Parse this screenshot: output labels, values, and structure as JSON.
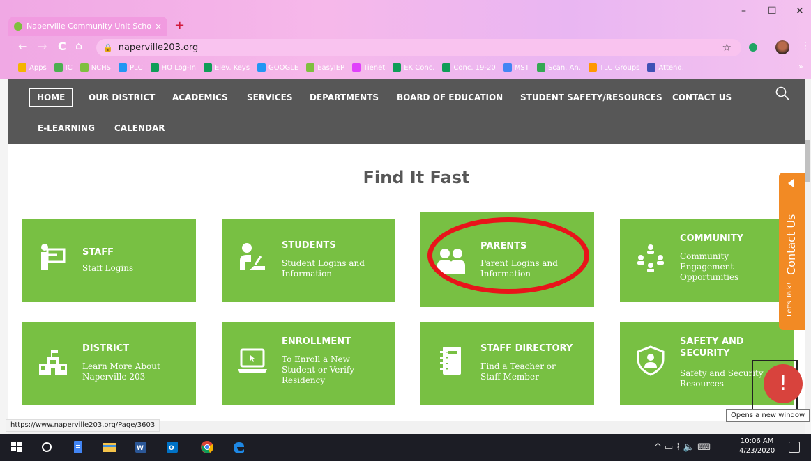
{
  "browser": {
    "tab_title": "Naperville Community Unit Scho",
    "tab_close": "×",
    "new_tab": "+",
    "url": "naperville203.org",
    "window_controls": {
      "minimize": "–",
      "maximize": "☐",
      "close": "✕"
    },
    "nav": {
      "back": "←",
      "forward": "→",
      "reload": "C",
      "home": "⌂",
      "star": "☆",
      "menu": "⋮"
    },
    "bookmarks": [
      {
        "label": "Apps",
        "color": "#f4b400"
      },
      {
        "label": "IC",
        "color": "#4caf50"
      },
      {
        "label": "NCHS",
        "color": "#7fbf3f"
      },
      {
        "label": "PLC",
        "color": "#2196f3"
      },
      {
        "label": "HO Log-In",
        "color": "#0f9d58"
      },
      {
        "label": "Elev. Keys",
        "color": "#0f9d58"
      },
      {
        "label": "GOOGLE",
        "color": "#2196f3"
      },
      {
        "label": "EasyIEP",
        "color": "#7fbf3f"
      },
      {
        "label": "Tienet",
        "color": "#e040fb"
      },
      {
        "label": "EK Conc.",
        "color": "#0f9d58"
      },
      {
        "label": "Conc. 19-20",
        "color": "#0f9d58"
      },
      {
        "label": "MST",
        "color": "#4285f4"
      },
      {
        "label": "Scan. An.",
        "color": "#34a853"
      },
      {
        "label": "TLC Groups",
        "color": "#ff9800"
      },
      {
        "label": "Attend.",
        "color": "#3f51b5"
      }
    ],
    "bookmarks_more": "»",
    "status_url": "https://www.naperville203.org/Page/3603",
    "tooltip": "Opens a new window"
  },
  "site": {
    "nav_row1": [
      "HOME",
      "OUR DISTRICT",
      "ACADEMICS",
      "SERVICES",
      "DEPARTMENTS",
      "BOARD OF EDUCATION",
      "STUDENT SAFETY/RESOURCES",
      "CONTACT US"
    ],
    "nav_row2": [
      "E-LEARNING",
      "CALENDAR"
    ],
    "heading": "Find It Fast",
    "cards": [
      {
        "title": "STAFF",
        "desc": "Staff Logins",
        "icon": "teacher-board-icon"
      },
      {
        "title": "STUDENTS",
        "desc": "Student Logins and Information",
        "icon": "student-desk-icon"
      },
      {
        "title": "PARENTS",
        "desc": "Parent Logins and Information",
        "icon": "parents-icon"
      },
      {
        "title": "COMMUNITY",
        "desc": "Community Engagement Opportunities",
        "icon": "community-icon"
      },
      {
        "title": "DISTRICT",
        "desc": "Learn More About Naperville 203",
        "icon": "school-building-icon"
      },
      {
        "title": "ENROLLMENT",
        "desc": "To Enroll a New Student or Verify Residency",
        "icon": "laptop-icon"
      },
      {
        "title": "STAFF DIRECTORY",
        "desc": "Find a Teacher or Staff Member",
        "icon": "notebook-icon"
      },
      {
        "title": "SAFETY AND SECURITY",
        "desc": "Safety and Security Resources",
        "icon": "shield-person-icon"
      }
    ],
    "contact_tab": "Contact Us",
    "lets_talk": "Let's Talk!",
    "alert_button": "!"
  },
  "taskbar": {
    "time": "10:06 AM",
    "date": "4/23/2020",
    "tray": "^ ▭ ⌇ 🔈 ⌨"
  }
}
